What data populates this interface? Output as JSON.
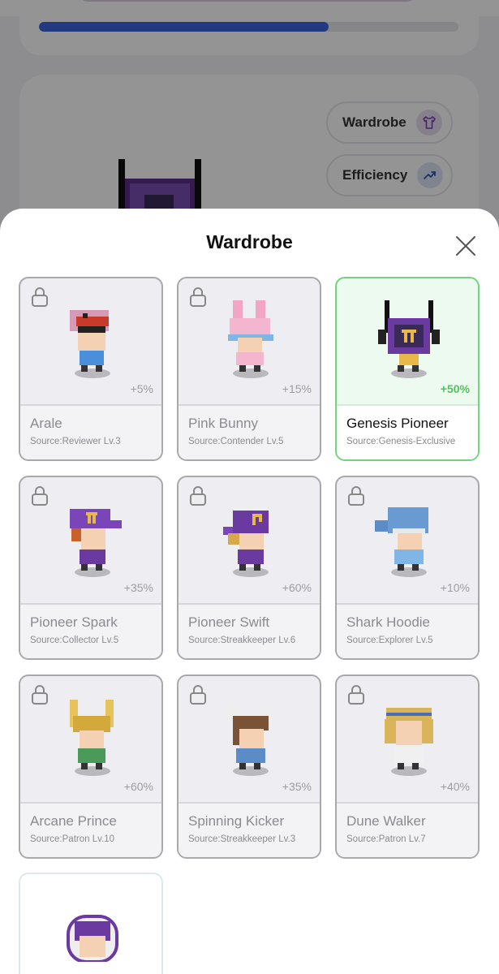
{
  "background": {
    "progress_fraction": 0.69,
    "chips": [
      {
        "label": "Wardrobe",
        "icon": "shirt-icon",
        "icon_bg": "#e7dcf2",
        "icon_color": "#7a3fb0"
      },
      {
        "label": "Efficiency",
        "icon": "trend-up-icon",
        "icon_bg": "#dbe4f5",
        "icon_color": "#3356b8"
      }
    ]
  },
  "modal": {
    "title": "Wardrobe",
    "close_icon": "close-icon"
  },
  "outfits": [
    {
      "name": "Arale",
      "source": "Source:Reviewer Lv.3",
      "bonus": "+5%",
      "locked": true,
      "selected": false
    },
    {
      "name": "Pink Bunny",
      "source": "Source:Contender Lv.5",
      "bonus": "+15%",
      "locked": true,
      "selected": false
    },
    {
      "name": "Genesis Pioneer",
      "source": "Source:Genesis-Exclusive",
      "bonus": "+50%",
      "locked": false,
      "selected": true
    },
    {
      "name": "Pioneer Spark",
      "source": "Source:Collector Lv.5",
      "bonus": "+35%",
      "locked": true,
      "selected": false
    },
    {
      "name": "Pioneer Swift",
      "source": "Source:Streakkeeper Lv.6",
      "bonus": "+60%",
      "locked": true,
      "selected": false
    },
    {
      "name": "Shark Hoodie",
      "source": "Source:Explorer Lv.5",
      "bonus": "+10%",
      "locked": true,
      "selected": false
    },
    {
      "name": "Arcane Prince",
      "source": "Source:Patron Lv.10",
      "bonus": "+60%",
      "locked": true,
      "selected": false
    },
    {
      "name": "Spinning Kicker",
      "source": "Source:Streakkeeper Lv.3",
      "bonus": "+35%",
      "locked": true,
      "selected": false
    },
    {
      "name": "Dune Walker",
      "source": "Source:Patron Lv.7",
      "bonus": "+40%",
      "locked": true,
      "selected": false
    },
    {
      "name": "",
      "source": "",
      "bonus": "",
      "locked": false,
      "selected": false
    }
  ],
  "colors": {
    "accent_selected": "#6fd67c",
    "bonus_selected": "#4fc35d",
    "progress": "#3a63d9"
  }
}
